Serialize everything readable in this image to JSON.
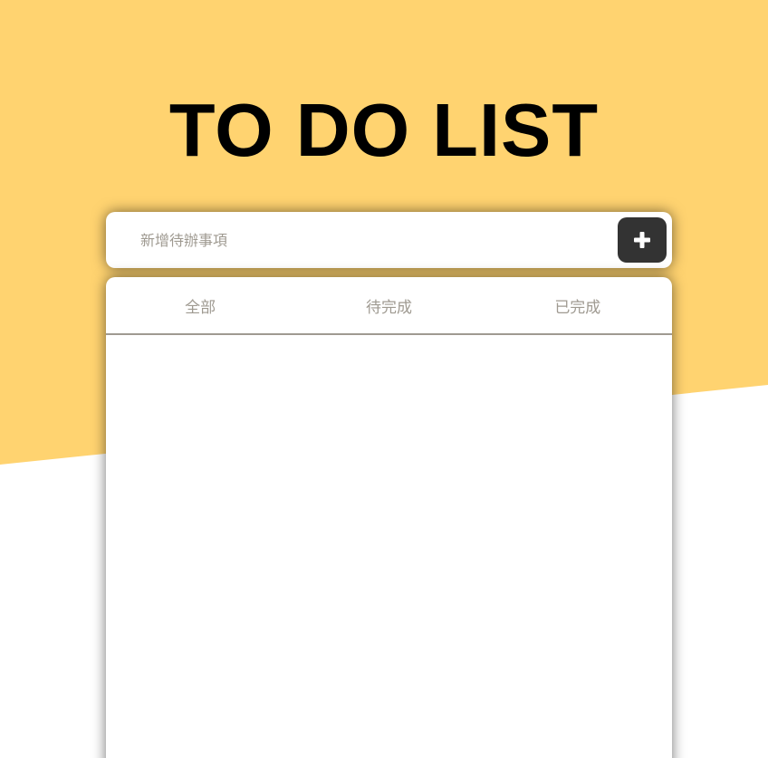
{
  "app": {
    "title": "TO DO LIST"
  },
  "add_form": {
    "placeholder": "新增待辦事項",
    "value": "",
    "add_button_icon": "plus-icon"
  },
  "tabs": [
    {
      "label": "全部"
    },
    {
      "label": "待完成"
    },
    {
      "label": "已完成"
    }
  ],
  "todos": [],
  "colors": {
    "background_accent": "#ffd370",
    "button": "#333333",
    "tab_text": "#9f9a91",
    "title": "#000000"
  }
}
